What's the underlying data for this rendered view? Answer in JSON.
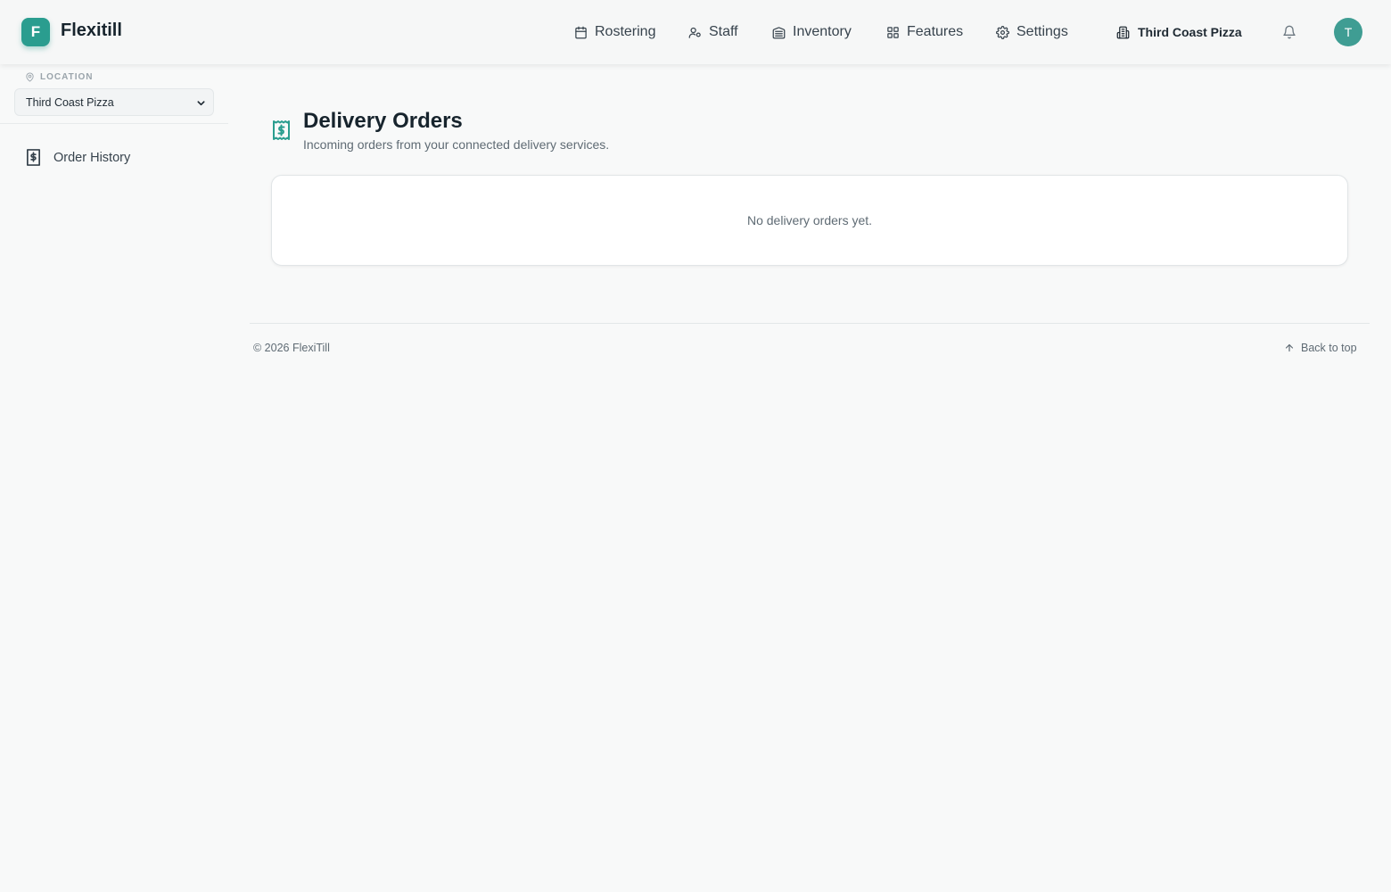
{
  "app": {
    "logo_letter": "F",
    "name": "Flexitill"
  },
  "nav": {
    "items": [
      {
        "label": "Rostering",
        "icon": "calendar-icon"
      },
      {
        "label": "Staff",
        "icon": "user-icon"
      },
      {
        "label": "Inventory",
        "icon": "warehouse-icon"
      },
      {
        "label": "Features",
        "icon": "grid-icon"
      },
      {
        "label": "Settings",
        "icon": "gear-icon"
      }
    ],
    "location": "Third Coast Pizza",
    "avatar_letter": "T"
  },
  "sidebar": {
    "location_label": "LOCATION",
    "location_selected": "Third Coast Pizza",
    "items": [
      {
        "label": "Order History",
        "icon": "receipt-icon"
      }
    ]
  },
  "main": {
    "title": "Delivery Orders",
    "subtitle": "Incoming orders from your connected delivery services.",
    "empty_message": "No delivery orders yet."
  },
  "footer": {
    "copyright": "© 2026 FlexiTill",
    "back_to_top": "Back to top"
  },
  "colors": {
    "accent": "#2a9d8f",
    "avatar": "#3f9d93",
    "background": "#f8f9f9"
  }
}
